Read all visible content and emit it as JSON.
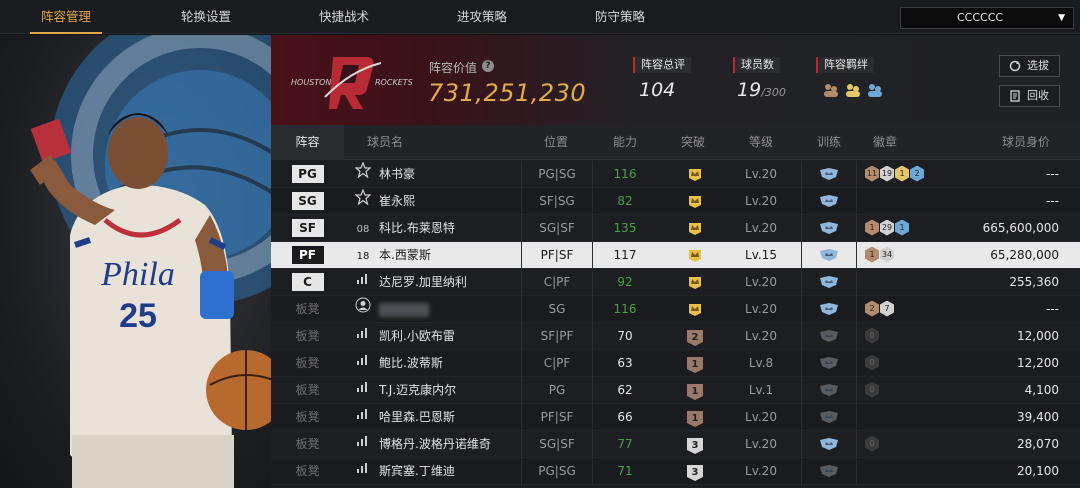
{
  "tabs": [
    {
      "label": "阵容管理"
    },
    {
      "label": "轮换设置"
    },
    {
      "label": "快捷战术"
    },
    {
      "label": "进攻策略"
    },
    {
      "label": "防守策略"
    }
  ],
  "dropdown": {
    "value": "CCCCCC"
  },
  "hero": {
    "jersey_text": "Phila",
    "jersey_number": "25"
  },
  "header": {
    "logo_text": "HOUSTON ROCKETS",
    "value_label": "阵容价值",
    "value": "731,251,230",
    "stats": [
      {
        "label": "阵容总评",
        "value": "104",
        "suffix": ""
      },
      {
        "label": "球员数",
        "value": "19",
        "suffix": "/300"
      },
      {
        "label": "阵容羁绊",
        "value": "",
        "suffix": ""
      }
    ],
    "btn_select": "选拔",
    "btn_return": "回收"
  },
  "columns": [
    "阵容",
    "球员名",
    "位置",
    "能力",
    "突破",
    "等级",
    "训练",
    "徽章",
    "球员身价"
  ],
  "rows": [
    {
      "pos": "PG",
      "tag": "star",
      "name": "林书豪",
      "role": "PG|SG",
      "ability": "116",
      "ability_color": "green",
      "breakthrough": "crown",
      "level": "Lv.20",
      "badges": [
        [
          "11",
          "brown"
        ],
        [
          "19",
          "silver"
        ],
        [
          "1",
          "gold"
        ],
        [
          "2",
          "blue"
        ]
      ],
      "value": "---"
    },
    {
      "pos": "SG",
      "tag": "star",
      "name": "崔永熙",
      "role": "SF|SG",
      "ability": "82",
      "ability_color": "green",
      "breakthrough": "crown",
      "level": "Lv.20",
      "badges": [],
      "value": "---"
    },
    {
      "pos": "SF",
      "tag": "08",
      "name": "科比.布莱恩特",
      "role": "SG|SF",
      "ability": "135",
      "ability_color": "green",
      "breakthrough": "crown",
      "level": "Lv.20",
      "badges": [
        [
          "1",
          "brown"
        ],
        [
          "29",
          "silver"
        ],
        [
          "1",
          "blue"
        ]
      ],
      "value": "665,600,000"
    },
    {
      "pos": "PF",
      "tag": "18",
      "name": "本.西蒙斯",
      "role": "PF|SF",
      "ability": "117",
      "ability_color": "white",
      "breakthrough": "crown",
      "level": "Lv.15",
      "badges": [
        [
          "1",
          "brown"
        ],
        [
          "34",
          "silver"
        ]
      ],
      "value": "65,280,000",
      "selected": true
    },
    {
      "pos": "C",
      "tag": "bars",
      "name": "达尼罗.加里纳利",
      "role": "C|PF",
      "ability": "92",
      "ability_color": "green",
      "breakthrough": "crown",
      "level": "Lv.20",
      "badges": [],
      "value": "255,360"
    },
    {
      "pos": "板凳",
      "tag": "person",
      "name": "",
      "role": "SG",
      "ability": "116",
      "ability_color": "green",
      "breakthrough": "crown",
      "level": "Lv.20",
      "badges": [
        [
          "2",
          "brown"
        ],
        [
          "7",
          "silver"
        ]
      ],
      "value": "---",
      "blurred": true
    },
    {
      "pos": "板凳",
      "tag": "bars",
      "name": "凯利.小欧布雷",
      "role": "SF|PF",
      "ability": "70",
      "ability_color": "white",
      "breakthrough": "2",
      "level": "Lv.20",
      "badges": [
        [
          "0",
          "dark"
        ]
      ],
      "value": "12,000"
    },
    {
      "pos": "板凳",
      "tag": "bars",
      "name": "鲍比.波蒂斯",
      "role": "C|PF",
      "ability": "63",
      "ability_color": "white",
      "breakthrough": "1",
      "level": "Lv.8",
      "badges": [
        [
          "0",
          "dark"
        ]
      ],
      "value": "12,200"
    },
    {
      "pos": "板凳",
      "tag": "bars",
      "name": "T.J.迈克康内尔",
      "role": "PG",
      "ability": "62",
      "ability_color": "white",
      "breakthrough": "1",
      "level": "Lv.1",
      "badges": [
        [
          "0",
          "dark"
        ]
      ],
      "value": "4,100"
    },
    {
      "pos": "板凳",
      "tag": "bars",
      "name": "哈里森.巴恩斯",
      "role": "PF|SF",
      "ability": "66",
      "ability_color": "white",
      "breakthrough": "1",
      "level": "Lv.20",
      "badges": [],
      "value": "39,400"
    },
    {
      "pos": "板凳",
      "tag": "bars",
      "name": "博格丹.波格丹诺维奇",
      "role": "SG|SF",
      "ability": "77",
      "ability_color": "green",
      "breakthrough": "3",
      "level": "Lv.20",
      "badges": [
        [
          "0",
          "dark"
        ]
      ],
      "value": "28,070"
    },
    {
      "pos": "板凳",
      "tag": "bars",
      "name": "斯宾塞.丁维迪",
      "role": "PG|SG",
      "ability": "71",
      "ability_color": "green",
      "breakthrough": "3",
      "level": "Lv.20",
      "badges": [],
      "value": "20,100"
    }
  ],
  "colors": {
    "accent": "#e0a84a",
    "green": "#4aa04a",
    "red": "#c0272d"
  }
}
